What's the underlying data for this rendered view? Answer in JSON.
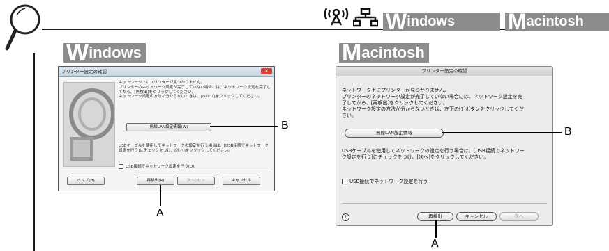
{
  "header": {
    "tag_windows": {
      "initial": "W",
      "rest": "indows"
    },
    "tag_macintosh": {
      "initial": "M",
      "rest": "acintosh"
    }
  },
  "sections": {
    "windows": {
      "initial": "W",
      "rest": "indows"
    },
    "macintosh": {
      "initial": "M",
      "rest": "acintosh"
    }
  },
  "win_dialog": {
    "title": "プリンター設定の確認",
    "message": [
      "ネットワーク上にプリンターが見つかりません。",
      "プリンターのネットワーク設定が完了していない場合には、ネットワーク設定を完了し",
      "てから、[再検出]をクリックしてください。",
      "ネットワーク設定の方法が分からないときは、[ヘルプ]をクリックしてください。"
    ],
    "wireless_button": "無線LAN設定情報(W)",
    "usb_text": [
      "USBケーブルを使用してネットワークの設定を行う場合は、[USB接続でネットワーク",
      "設定を行う]にチェックをつけ、[次へ]をクリックしてください。"
    ],
    "usb_checkbox": "USB接続でネットワーク設定を行う(U)",
    "buttons": {
      "help": "ヘルプ(H)",
      "redetect": "再検出(R)",
      "next": "次へ(N) >",
      "cancel": "キャンセル"
    }
  },
  "mac_dialog": {
    "title": "プリンター設定の確認",
    "message": [
      "ネットワーク上にプリンターが見つかりません。",
      "プリンターのネットワーク設定が完了していない場合には、ネットワーク設定を完",
      "了してから、[再検出]をクリックしてください。",
      "ネットワーク設定の方法が分からないときは、左下の[?]ボタンをクリックしてくだ",
      "さい。"
    ],
    "wireless_button": "無線LAN設定情報",
    "usb_text": [
      "USBケーブルを使用してネットワークの設定を行う場合は、[USB接続でネットワー",
      "ク設定を行う]にチェックをつけ、[次へ]をクリックしてください。"
    ],
    "usb_checkbox": "USB接続でネットワーク設定を行う",
    "help_symbol": "?",
    "buttons": {
      "redetect": "再検出",
      "cancel": "キャンセル",
      "next": "次へ"
    }
  },
  "callouts": {
    "a": "A",
    "b": "B"
  },
  "colors": {
    "tag_gray": "#8c8c8c",
    "rule": "#1a1a1a"
  },
  "icons": [
    "magnifier-icon",
    "wireless-icon",
    "network-icon"
  ]
}
